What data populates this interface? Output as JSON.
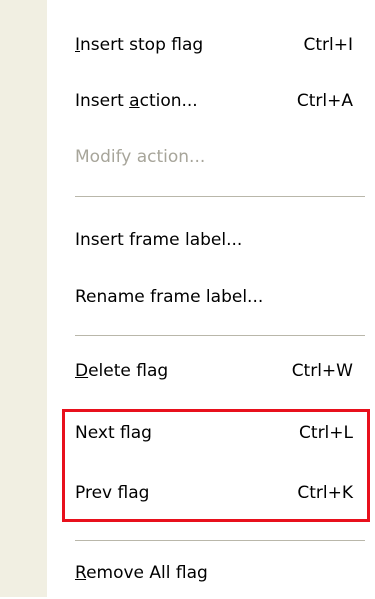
{
  "menu": {
    "items": [
      {
        "pre": "",
        "ul": "I",
        "post": "nsert stop flag",
        "shortcut": "Ctrl+I"
      },
      {
        "pre": "Insert ",
        "ul": "a",
        "post": "ction...",
        "shortcut": "Ctrl+A"
      },
      {
        "pre": "Modify action...",
        "ul": "",
        "post": "",
        "shortcut": ""
      },
      {
        "pre": "Insert frame label...",
        "ul": "",
        "post": "",
        "shortcut": ""
      },
      {
        "pre": "Rename frame label...",
        "ul": "",
        "post": "",
        "shortcut": ""
      },
      {
        "pre": "",
        "ul": "D",
        "post": "elete flag",
        "shortcut": "Ctrl+W"
      },
      {
        "pre": "Next flag",
        "ul": "",
        "post": "",
        "shortcut": "Ctrl+L"
      },
      {
        "pre": "Prev flag",
        "ul": "",
        "post": "",
        "shortcut": "Ctrl+K"
      },
      {
        "pre": "",
        "ul": "R",
        "post": "emove All flag",
        "shortcut": ""
      }
    ]
  },
  "colors": {
    "gutter": "#f1efe2",
    "disabled_text": "#a7a59a",
    "highlight_border": "#e8101c",
    "separator": "#b9b7aa"
  }
}
